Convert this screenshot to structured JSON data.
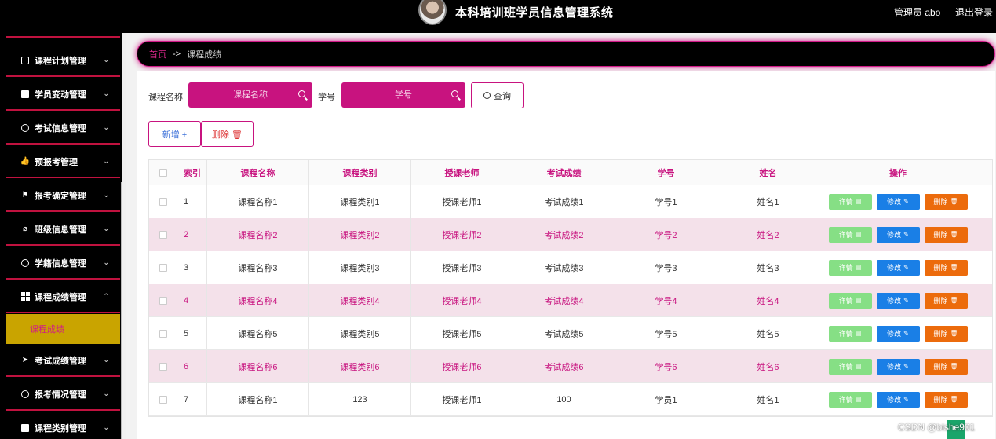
{
  "header": {
    "title": "本科培训班学员信息管理系统",
    "user_label": "管理员 abo",
    "logout_label": "退出登录"
  },
  "sidebar": {
    "items": [
      {
        "label": "课程计划管理",
        "icon": "copy-icon",
        "chevron": "⌄"
      },
      {
        "label": "学员变动管理",
        "icon": "chart-icon",
        "chevron": "⌄"
      },
      {
        "label": "考试信息管理",
        "icon": "compass-icon",
        "chevron": "⌄"
      },
      {
        "label": "预报考管理",
        "icon": "thumb-up-icon",
        "chevron": "⌄"
      },
      {
        "label": "报考确定管理",
        "icon": "flag-icon",
        "chevron": "⌄"
      },
      {
        "label": "班级信息管理",
        "icon": "bell-off-icon",
        "chevron": "⌄"
      },
      {
        "label": "学籍信息管理",
        "icon": "dashboard-icon",
        "chevron": "⌄"
      },
      {
        "label": "课程成绩管理",
        "icon": "grid-icon",
        "chevron": "⌃"
      },
      {
        "label": "考试成绩管理",
        "icon": "send-icon",
        "chevron": "⌄"
      },
      {
        "label": "报考情况管理",
        "icon": "help-icon",
        "chevron": "⌄"
      },
      {
        "label": "课程类别管理",
        "icon": "monitor-icon",
        "chevron": "⌄"
      }
    ],
    "active_sub": "课程成绩"
  },
  "breadcrumb": {
    "home": "首页",
    "separator": "->",
    "current": "课程成绩"
  },
  "search": {
    "course_label": "课程名称",
    "course_placeholder": "课程名称",
    "student_label": "学号",
    "student_placeholder": "学号",
    "query_label": "查询"
  },
  "actions": {
    "add_label": "新增 +",
    "delete_label": "删除 🗑"
  },
  "table": {
    "headers": [
      "索引",
      "课程名称",
      "课程类别",
      "授课老师",
      "考试成绩",
      "学号",
      "姓名",
      "操作"
    ],
    "rows": [
      [
        "1",
        "课程名称1",
        "课程类别1",
        "授课老师1",
        "考试成绩1",
        "学号1",
        "姓名1"
      ],
      [
        "2",
        "课程名称2",
        "课程类别2",
        "授课老师2",
        "考试成绩2",
        "学号2",
        "姓名2"
      ],
      [
        "3",
        "课程名称3",
        "课程类别3",
        "授课老师3",
        "考试成绩3",
        "学号3",
        "姓名3"
      ],
      [
        "4",
        "课程名称4",
        "课程类别4",
        "授课老师4",
        "考试成绩4",
        "学号4",
        "姓名4"
      ],
      [
        "5",
        "课程名称5",
        "课程类别5",
        "授课老师5",
        "考试成绩5",
        "学号5",
        "姓名5"
      ],
      [
        "6",
        "课程名称6",
        "课程类别6",
        "授课老师6",
        "考试成绩6",
        "学号6",
        "姓名6"
      ],
      [
        "7",
        "课程名称1",
        "123",
        "授课老师1",
        "100",
        "学员1",
        "姓名1"
      ]
    ],
    "op_labels": {
      "detail": "详情",
      "edit": "修改",
      "delete": "删除"
    }
  },
  "watermark": "CSDN @bishe901",
  "colors": {
    "accent": "#c8137f",
    "detail": "#86df85",
    "edit": "#1a7fe6",
    "delete": "#ec6b0c",
    "active_sub_bg": "#c9a400"
  }
}
